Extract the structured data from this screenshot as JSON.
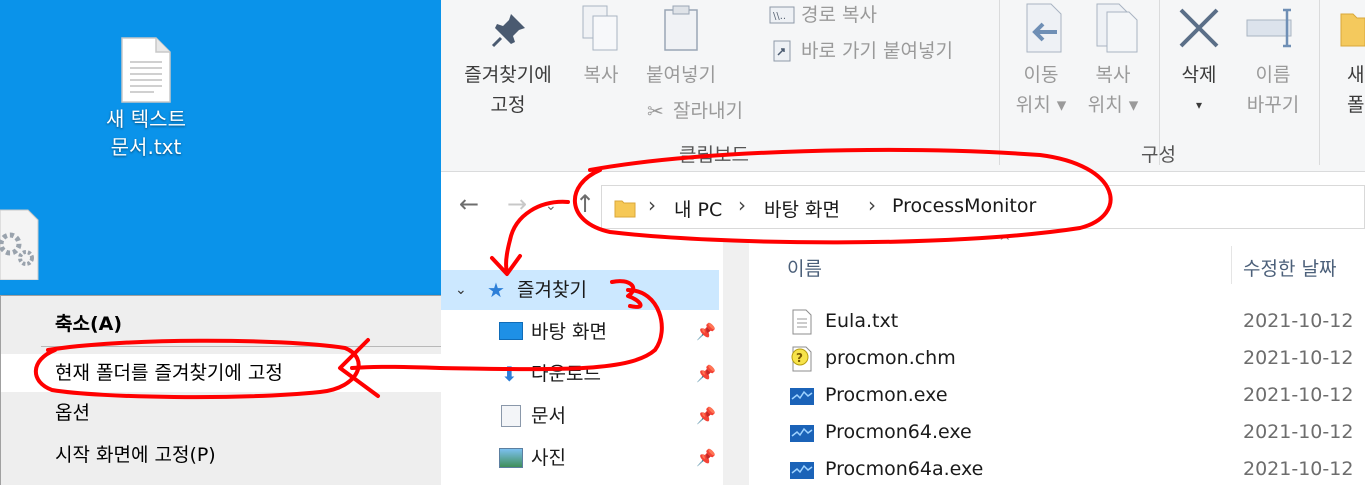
{
  "desktop": {
    "file_label_line1": "새 텍스트",
    "file_label_line2": "문서.txt"
  },
  "context_menu": {
    "items": [
      {
        "label": "축소(A)"
      },
      {
        "label": "현재 폴더를 즐겨찾기에 고정"
      },
      {
        "label": "옵션"
      },
      {
        "label": "시작 화면에 고정(P)"
      }
    ]
  },
  "ribbon": {
    "pin_line1": "즐겨찾기에",
    "pin_line2": "고정",
    "copy": "복사",
    "paste": "붙여넣기",
    "copy_path": "경로 복사",
    "paste_shortcut": "바로 가기 붙여넣기",
    "cut": "잘라내기",
    "group_clipboard": "클립보드",
    "move_line1": "이동",
    "move_line2": "위치 ▾",
    "copyto_line1": "복사",
    "copyto_line2": "위치 ▾",
    "delete_line1": "삭제",
    "delete_line2": "▾",
    "rename_line1": "이름",
    "rename_line2": "바꾸기",
    "new_line1": "새",
    "new_line2": "폴더",
    "group_organize": "구성"
  },
  "address": {
    "crumbs": [
      "내 PC",
      "바탕 화면",
      "ProcessMonitor"
    ]
  },
  "nav_pane": {
    "items": [
      {
        "label": "즐겨찾기"
      },
      {
        "label": "바탕 화면"
      },
      {
        "label": "다운로드"
      },
      {
        "label": "문서"
      },
      {
        "label": "사진"
      }
    ]
  },
  "file_list": {
    "col_name": "이름",
    "col_modified": "수정한 날짜",
    "rows": [
      {
        "name": "Eula.txt",
        "date": "2021-10-12"
      },
      {
        "name": "procmon.chm",
        "date": "2021-10-12"
      },
      {
        "name": "Procmon.exe",
        "date": "2021-10-12"
      },
      {
        "name": "Procmon64.exe",
        "date": "2021-10-12"
      },
      {
        "name": "Procmon64a.exe",
        "date": "2021-10-12"
      }
    ]
  },
  "colors": {
    "desktop_bg": "#0a93ea",
    "selection": "#cce8ff",
    "annotation_red": "#ff0000"
  }
}
